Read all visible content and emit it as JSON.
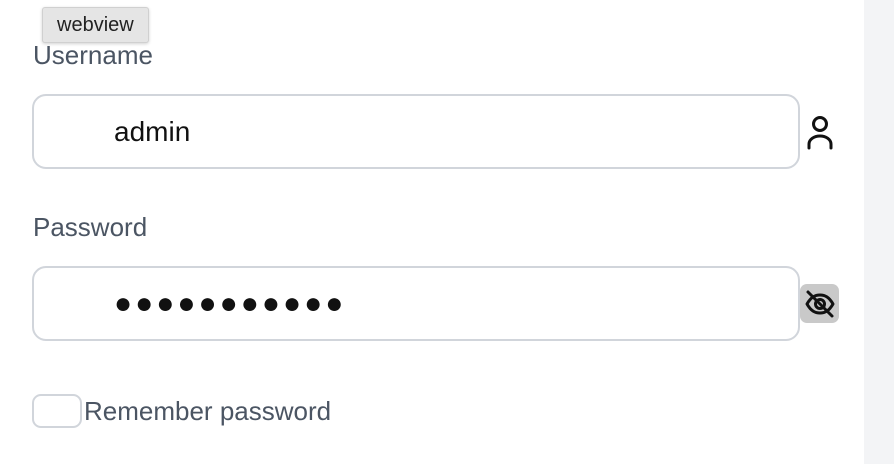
{
  "tooltip": {
    "text": "webview"
  },
  "form": {
    "username": {
      "label": "Username",
      "value": "admin",
      "icon": "user-icon"
    },
    "password": {
      "label": "Password",
      "masked_value": "●●●●●●●●●●●",
      "toggle_icon": "eye-off-icon"
    },
    "remember": {
      "label": "Remember password",
      "checked": false
    }
  },
  "colors": {
    "label_text": "#4b5563",
    "input_border": "#d1d5db",
    "side_panel": "#f3f4f6",
    "toggle_bg": "#c9c9c9"
  }
}
